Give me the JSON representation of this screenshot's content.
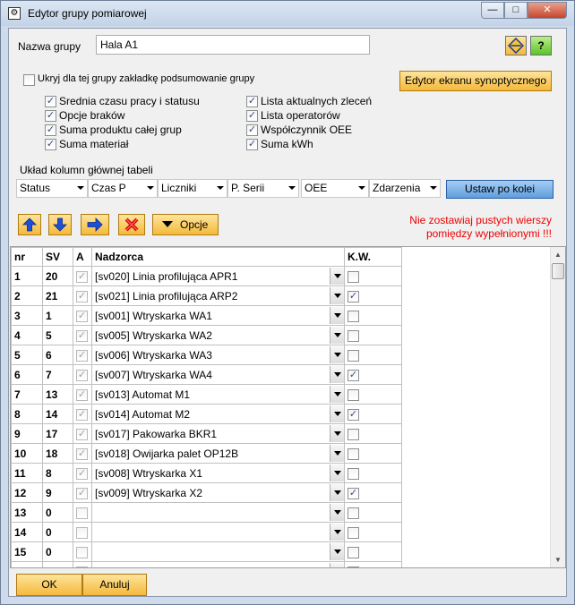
{
  "window": {
    "title": "Edytor grupy pomiarowej",
    "min_glyph": "—",
    "max_glyph": "□",
    "close_glyph": "✕",
    "app_glyph": "⚙"
  },
  "group": {
    "name_label": "Nazwa grupy",
    "name_value": "Hala A1"
  },
  "help_button": "?",
  "hide_summary": {
    "label": "Ukryj dla tej grupy zakładkę podsumowanie grupy",
    "checked": false
  },
  "synoptic_button": "Edytor ekranu synoptycznego",
  "options": [
    {
      "label": "Srednia czasu pracy i statusu",
      "checked": true
    },
    {
      "label": "Opcje braków",
      "checked": true
    },
    {
      "label": "Suma produktu całej grup",
      "checked": true
    },
    {
      "label": "Suma materiał",
      "checked": true
    },
    {
      "label": "Lista aktualnych zleceń",
      "checked": true
    },
    {
      "label": "Lista operatorów",
      "checked": true
    },
    {
      "label": "Współczynnik OEE",
      "checked": true
    },
    {
      "label": "Suma kWh",
      "checked": true
    }
  ],
  "columns_layout": {
    "label": "Układ kolumn głównej tabeli",
    "combos": [
      "Status",
      "Czas P",
      "Liczniki",
      "P. Serii",
      "OEE",
      "Zdarzenia"
    ],
    "apply_button": "Ustaw po kolei"
  },
  "toolbar": {
    "options_label": "Opcje",
    "warning_line1": "Nie zostawiaj pustych wierszy",
    "warning_line2": "pomiędzy wypełnionymi !!!"
  },
  "table": {
    "headers": [
      "nr",
      "SV",
      "A",
      "Nadzorca",
      "K.W."
    ],
    "rows": [
      {
        "nr": "1",
        "sv": "20",
        "a": true,
        "sup": "[sv020] Linia profilująca APR1",
        "kw": false
      },
      {
        "nr": "2",
        "sv": "21",
        "a": true,
        "sup": "[sv021] Linia profilująca ARP2",
        "kw": true
      },
      {
        "nr": "3",
        "sv": "1",
        "a": true,
        "sup": "[sv001] Wtryskarka WA1",
        "kw": false
      },
      {
        "nr": "4",
        "sv": "5",
        "a": true,
        "sup": "[sv005] Wtryskarka WA2",
        "kw": false
      },
      {
        "nr": "5",
        "sv": "6",
        "a": true,
        "sup": "[sv006] Wtryskarka WA3",
        "kw": false
      },
      {
        "nr": "6",
        "sv": "7",
        "a": true,
        "sup": "[sv007] Wtryskarka WA4",
        "kw": true
      },
      {
        "nr": "7",
        "sv": "13",
        "a": true,
        "sup": "[sv013] Automat M1",
        "kw": false
      },
      {
        "nr": "8",
        "sv": "14",
        "a": true,
        "sup": "[sv014] Automat M2",
        "kw": true
      },
      {
        "nr": "9",
        "sv": "17",
        "a": true,
        "sup": "[sv017] Pakowarka BKR1",
        "kw": false
      },
      {
        "nr": "10",
        "sv": "18",
        "a": true,
        "sup": "[sv018] Owijarka palet OP12B",
        "kw": false
      },
      {
        "nr": "11",
        "sv": "8",
        "a": true,
        "sup": "[sv008] Wtryskarka X1",
        "kw": false
      },
      {
        "nr": "12",
        "sv": "9",
        "a": true,
        "sup": "[sv009] Wtryskarka X2",
        "kw": true
      },
      {
        "nr": "13",
        "sv": "0",
        "a": false,
        "sup": "",
        "kw": false
      },
      {
        "nr": "14",
        "sv": "0",
        "a": false,
        "sup": "",
        "kw": false
      },
      {
        "nr": "15",
        "sv": "0",
        "a": false,
        "sup": "",
        "kw": false
      },
      {
        "nr": "16",
        "sv": "0",
        "a": false,
        "sup": "",
        "kw": false
      }
    ]
  },
  "buttons": {
    "ok": "OK",
    "cancel": "Anuluj"
  }
}
